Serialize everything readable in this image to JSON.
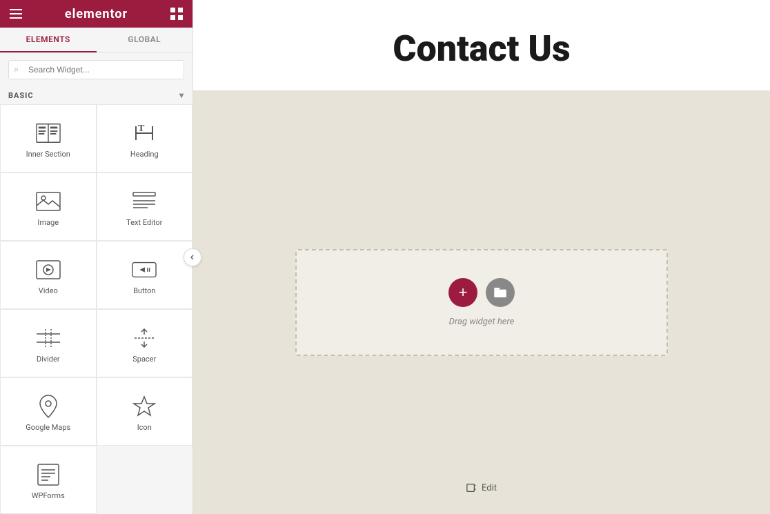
{
  "topbar": {
    "logo": "elementor",
    "hamburger_label": "menu",
    "grid_label": "apps"
  },
  "tabs": {
    "elements_label": "ELEMENTS",
    "global_label": "GLOBAL",
    "active": "elements"
  },
  "search": {
    "placeholder": "Search Widget..."
  },
  "basic_section": {
    "label": "BASIC",
    "chevron": "▾"
  },
  "widgets": [
    {
      "id": "inner-section",
      "label": "Inner Section",
      "icon": "inner-section-icon"
    },
    {
      "id": "heading",
      "label": "Heading",
      "icon": "heading-icon"
    },
    {
      "id": "image",
      "label": "Image",
      "icon": "image-icon"
    },
    {
      "id": "text-editor",
      "label": "Text Editor",
      "icon": "text-editor-icon"
    },
    {
      "id": "video",
      "label": "Video",
      "icon": "video-icon"
    },
    {
      "id": "button",
      "label": "Button",
      "icon": "button-icon"
    },
    {
      "id": "divider",
      "label": "Divider",
      "icon": "divider-icon"
    },
    {
      "id": "spacer",
      "label": "Spacer",
      "icon": "spacer-icon"
    },
    {
      "id": "google-maps",
      "label": "Google Maps",
      "icon": "google-maps-icon"
    },
    {
      "id": "icon",
      "label": "Icon",
      "icon": "icon-icon"
    },
    {
      "id": "wpforms",
      "label": "WPForms",
      "icon": "wpforms-icon"
    }
  ],
  "canvas": {
    "page_title": "Contact Us",
    "drop_zone_text": "Drag widget here",
    "add_button_label": "+",
    "folder_button_label": "⊞",
    "edit_label": "Edit"
  },
  "colors": {
    "brand": "#9b1c3e",
    "canvas_bg": "#e8e3d8",
    "drop_border": "#c5bfb0"
  }
}
